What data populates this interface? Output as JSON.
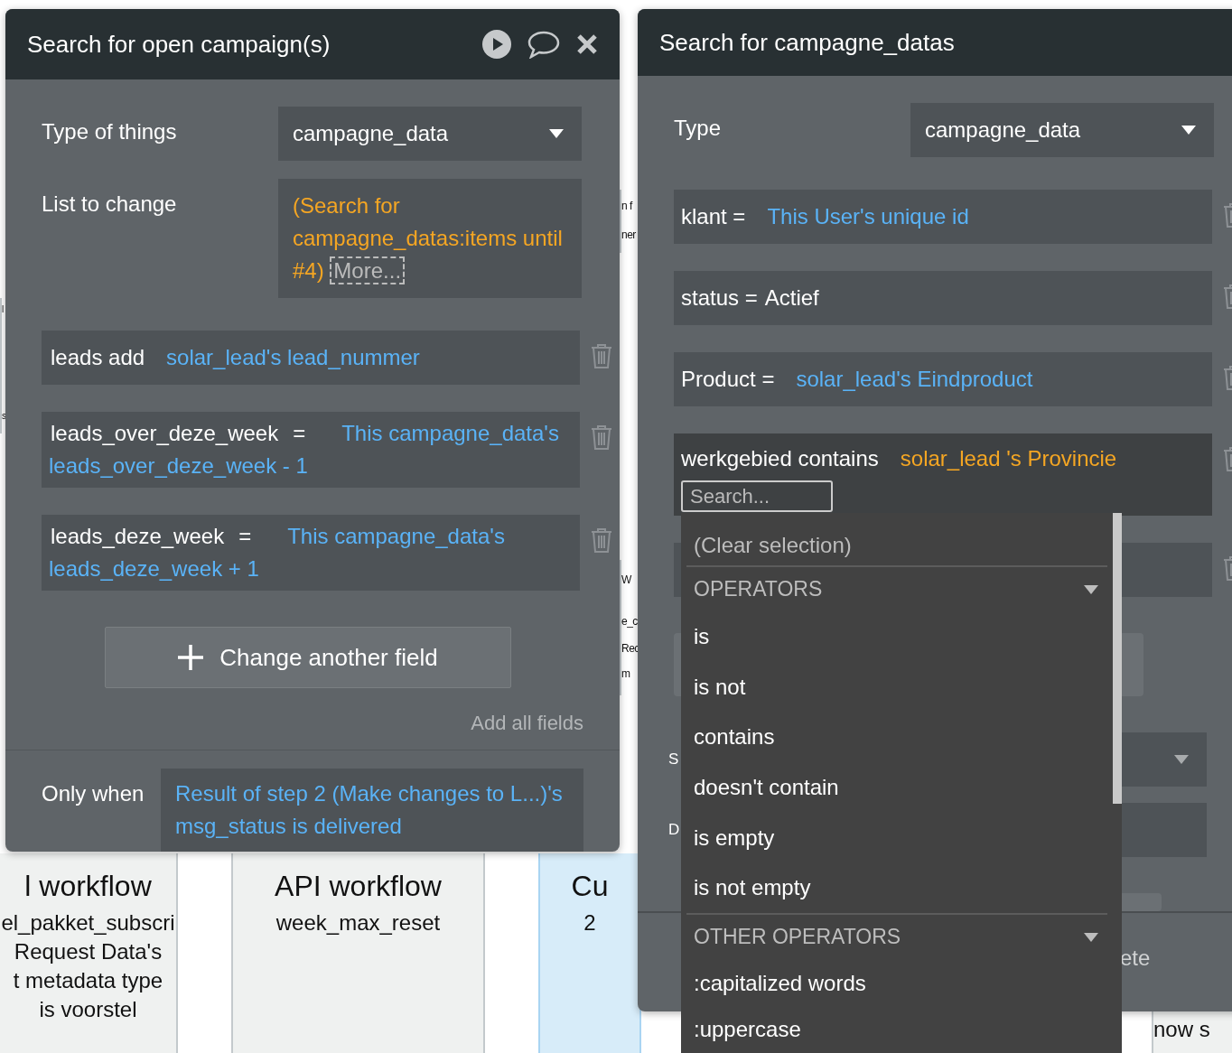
{
  "canvas": {
    "cards": [
      {
        "kind": "white",
        "texts": [
          "l",
          "s"
        ]
      },
      {
        "kind": "gray",
        "title": "l workflow",
        "lines": [
          "el_pakket_subscri",
          "Request Data's",
          "t metadata type",
          "is voorstel"
        ]
      },
      {
        "kind": "gray",
        "title": "API workflow",
        "lines": [
          "week_max_reset"
        ]
      },
      {
        "kind": "white",
        "texts": [
          "n f",
          "ner"
        ]
      },
      {
        "kind": "white",
        "texts": [
          "W",
          "e_c",
          "Rec",
          "m"
        ]
      },
      {
        "kind": "blue",
        "title": "Cu",
        "lines": [
          "2"
        ]
      },
      {
        "kind": "gray",
        "lines": [
          "now s"
        ]
      }
    ]
  },
  "left_panel": {
    "title": "Search for open campaign(s)",
    "type_of_things": {
      "label": "Type of things",
      "value": "campagne_data"
    },
    "list_to_change": {
      "label": "List to change",
      "value": "(Search for campagne_datas:items until #4)",
      "more": "More..."
    },
    "changes": [
      {
        "field": "leads add",
        "value": "solar_lead's lead_nummer",
        "kind": "inline"
      },
      {
        "field": "leads_over_deze_week",
        "operator": "=",
        "value": "This campagne_data's leads_over_deze_week - 1",
        "kind": "wrap"
      },
      {
        "field": "leads_deze_week",
        "operator": "=",
        "value": "This campagne_data's leads_deze_week + 1",
        "kind": "wrap"
      }
    ],
    "add_button": "Change another field",
    "add_all": "Add all fields",
    "only_when": {
      "label": "Only when",
      "value": "Result of step 2 (Make changes to L...)'s msg_status is delivered"
    }
  },
  "right_panel": {
    "title": "Search for campagne_datas",
    "type": {
      "label": "Type",
      "value": "campagne_data"
    },
    "constraints": [
      {
        "field": "klant =",
        "value": "This User's unique id",
        "kind": "dynamic",
        "active": false
      },
      {
        "field": "status =",
        "value": "Actief",
        "kind": "static",
        "active": false
      },
      {
        "field": "Product =",
        "value": "solar_lead's Eindproduct",
        "kind": "dynamic",
        "active": false
      },
      {
        "field": "werkgebied contains",
        "value": "solar_lead 's Provincie",
        "kind": "search",
        "active": true,
        "placeholder": "Search..."
      }
    ],
    "labels": [
      "S",
      "D"
    ],
    "footer_text": "ete"
  },
  "dropdown": {
    "clear": "(Clear selection)",
    "groups": [
      {
        "title": "OPERATORS",
        "expanded": true,
        "items": [
          "is",
          "is not",
          "contains",
          "doesn't contain",
          "is empty",
          "is not empty"
        ]
      },
      {
        "title": "OTHER OPERATORS",
        "expanded": true,
        "items": [
          ":capitalized words",
          ":uppercase"
        ]
      }
    ]
  }
}
